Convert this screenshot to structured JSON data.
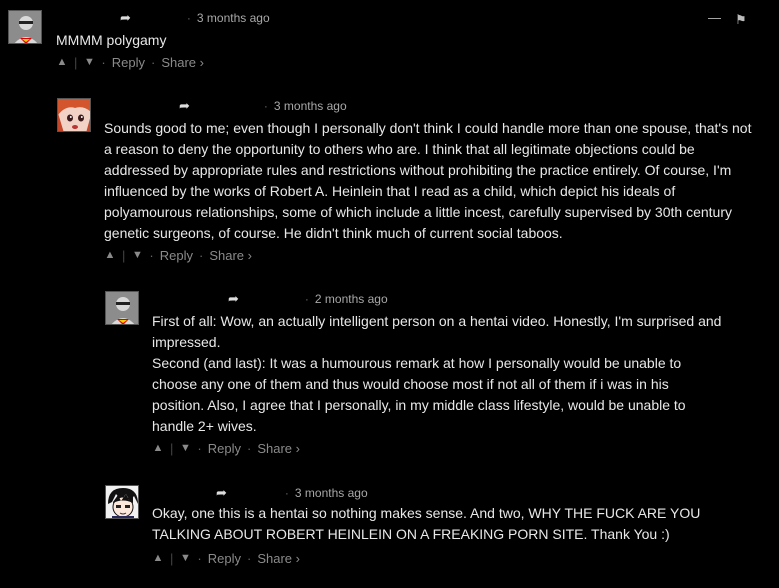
{
  "thread": {
    "minimize_glyph": "—",
    "flag_glyph": "⚑",
    "comments": [
      {
        "author": "",
        "time": "3 months ago",
        "text": [
          "MMMM polygamy"
        ],
        "actions": {
          "reply": "Reply",
          "share": "Share ›"
        },
        "avatar_icon": "superhero-avatar-icon"
      },
      {
        "author": "",
        "time": "3 months ago",
        "text": [
          "Sounds good to me; even though I personally don't think I could handle more than one spouse, that's not a reason to deny the opportunity to others who are. I think that all legitimate objections could be addressed by appropriate rules and restrictions without prohibiting the practice entirely. Of course, I'm influenced by the works of Robert A. Heinlein that I read as a child, which depict his ideals of polyamourous relationships, some of which include a little incest, carefully supervised by 30th century genetic surgeons, of course. He didn't think much of current social taboos."
        ],
        "actions": {
          "reply": "Reply",
          "share": "Share ›"
        },
        "avatar_icon": "anime-girl-avatar-icon"
      },
      {
        "author": "",
        "time": "2 months ago",
        "text": [
          "First of all: Wow, an actually intelligent person on a hentai video. Honestly, I'm surprised and impressed.",
          "Second (and last): It was a humourous remark at how I personally would be unable to choose any one of them and thus would choose most if not all of them if i was in his position. Also, I agree that I personally, in my middle class lifestyle, would be unable to handle 2+ wives."
        ],
        "actions": {
          "reply": "Reply",
          "share": "Share ›"
        },
        "avatar_icon": "superhero-avatar-icon"
      },
      {
        "author": "",
        "time": "3 months ago",
        "text": [
          "Okay, one this is a hentai so nothing makes sense. And two, WHY THE FUCK ARE YOU TALKING ABOUT ROBERT HEINLEIN ON A FREAKING PORN SITE. Thank You :)"
        ],
        "actions": {
          "reply": "Reply",
          "share": "Share ›"
        },
        "avatar_icon": "anime-boy-avatar-icon"
      }
    ]
  }
}
